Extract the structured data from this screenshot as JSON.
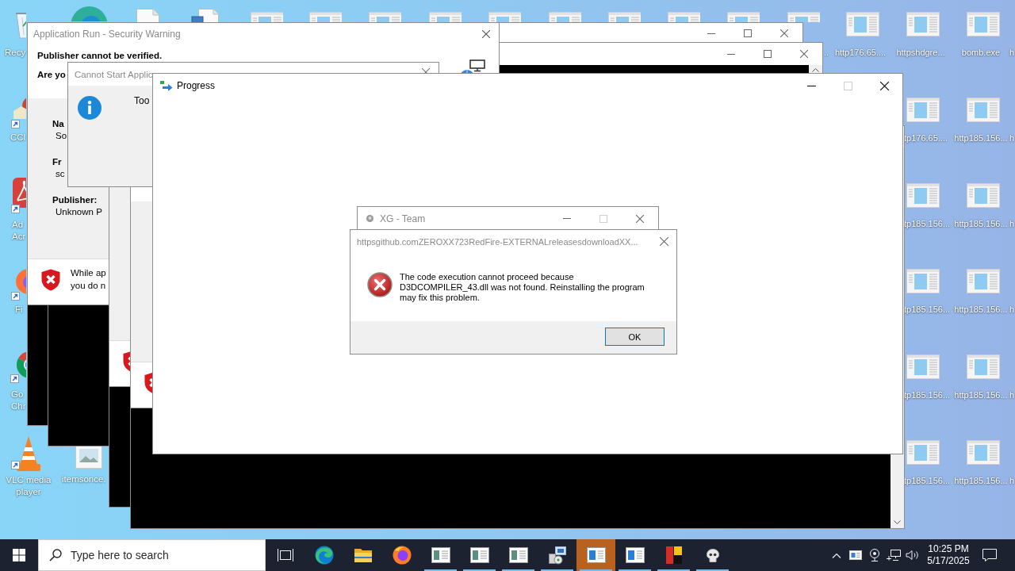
{
  "desktop_icons": [
    {
      "label": "Recy",
      "kind": "bin"
    },
    {
      "label": "CCl",
      "kind": "cleaner"
    },
    {
      "label": "Ad Acr",
      "kind": "acrobat"
    },
    {
      "label": "Fi",
      "kind": "firefox"
    },
    {
      "label": "Go Chr",
      "kind": "chrome"
    },
    {
      "label": "VLC media player",
      "kind": "vlc"
    },
    {
      "label": "itemsonce.",
      "kind": "image"
    },
    {
      "label": "..",
      "kind": "webpage"
    },
    {
      "label": "http176.65....",
      "kind": "webpage"
    },
    {
      "label": "httpshdgre...",
      "kind": "webpage"
    },
    {
      "label": "bomb.exe",
      "kind": "webpage"
    },
    {
      "label": "tp176.65....",
      "kind": "webpage"
    },
    {
      "label": "http185.156...",
      "kind": "webpage"
    },
    {
      "label": "tp185.156...",
      "kind": "webpage"
    },
    {
      "label": "http185.156...",
      "kind": "webpage"
    },
    {
      "label": "tp185.156...",
      "kind": "webpage"
    },
    {
      "label": "http185.156...",
      "kind": "webpage"
    },
    {
      "label": "tp185.156...",
      "kind": "webpage"
    },
    {
      "label": "http185.156...",
      "kind": "webpage"
    },
    {
      "label": "tp185.156...",
      "kind": "webpage"
    },
    {
      "label": "http185.156...",
      "kind": "webpage"
    }
  ],
  "right_edge_labels": [
    "h",
    "h",
    "h",
    "h",
    "h",
    "h"
  ],
  "security_warning": {
    "title": "Application Run - Security Warning",
    "active": false,
    "heading": "Publisher cannot be verified.",
    "question": "Are yo",
    "fields": [
      {
        "label": "Na",
        "value": "So"
      },
      {
        "label": "Fr",
        "value": "sc"
      },
      {
        "label": "Publisher:",
        "value": "Unknown P"
      }
    ],
    "notice": "While ap you do n"
  },
  "cannot_start_dialog": {
    "title": "Cannot Start Applic",
    "active": false,
    "message": "Too"
  },
  "progress_window": {
    "title": "Progress",
    "active": true,
    "caption_buttons": [
      {
        "kind": "minimize",
        "disabled": false
      },
      {
        "kind": "maximize",
        "disabled": true
      },
      {
        "kind": "close",
        "disabled": false
      }
    ]
  },
  "xg_window": {
    "title": "XG - Team",
    "active": false,
    "caption_buttons": [
      {
        "kind": "minimize",
        "disabled": false
      },
      {
        "kind": "maximize",
        "disabled": true
      },
      {
        "kind": "close",
        "disabled": false
      }
    ]
  },
  "error_dialog": {
    "title": "httpsgithub.comZEROXX723RedFire-EXTERNALreleasesdownloadXX...",
    "active": false,
    "message": "The code execution cannot proceed because D3DCOMPILER_43.dll was not found. Reinstalling the program may fix this problem.",
    "buttons": [
      {
        "label": "OK",
        "default": true
      }
    ]
  },
  "taskbar": {
    "search": {
      "placeholder": "Type here to search"
    },
    "apps": [
      {
        "kind": "taskview",
        "running": false,
        "attention": false
      },
      {
        "kind": "edge",
        "running": false,
        "attention": false
      },
      {
        "kind": "folder",
        "running": false,
        "attention": false
      },
      {
        "kind": "firefox",
        "running": false,
        "attention": false
      },
      {
        "kind": "card",
        "running": true,
        "attention": false
      },
      {
        "kind": "card",
        "running": true,
        "attention": false
      },
      {
        "kind": "card",
        "running": true,
        "attention": false
      },
      {
        "kind": "setup",
        "running": true,
        "attention": false
      },
      {
        "kind": "window",
        "running": true,
        "attention": true
      },
      {
        "kind": "window",
        "running": true,
        "attention": false
      },
      {
        "kind": "blocks",
        "running": true,
        "attention": false
      },
      {
        "kind": "skull",
        "running": true,
        "attention": false
      }
    ],
    "clock": {
      "time": "10:25 PM",
      "date": "5/17/2025"
    }
  }
}
